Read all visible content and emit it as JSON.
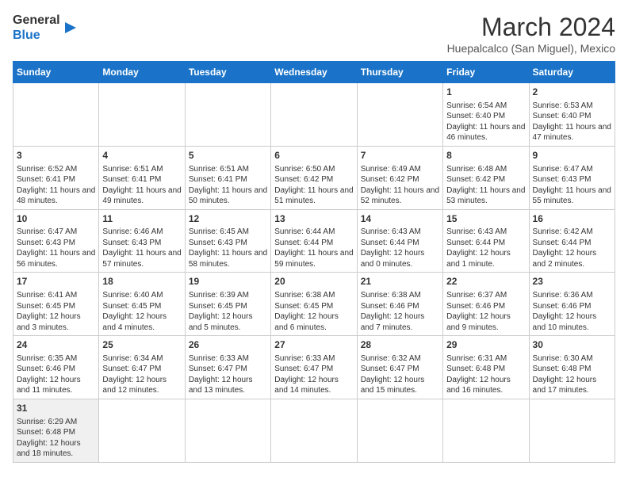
{
  "header": {
    "logo_general": "General",
    "logo_blue": "Blue",
    "title": "March 2024",
    "subtitle": "Huepalcalco (San Miguel), Mexico"
  },
  "weekdays": [
    "Sunday",
    "Monday",
    "Tuesday",
    "Wednesday",
    "Thursday",
    "Friday",
    "Saturday"
  ],
  "weeks": [
    [
      {
        "day": "",
        "info": ""
      },
      {
        "day": "",
        "info": ""
      },
      {
        "day": "",
        "info": ""
      },
      {
        "day": "",
        "info": ""
      },
      {
        "day": "",
        "info": ""
      },
      {
        "day": "1",
        "info": "Sunrise: 6:54 AM\nSunset: 6:40 PM\nDaylight: 11 hours and 46 minutes."
      },
      {
        "day": "2",
        "info": "Sunrise: 6:53 AM\nSunset: 6:40 PM\nDaylight: 11 hours and 47 minutes."
      }
    ],
    [
      {
        "day": "3",
        "info": "Sunrise: 6:52 AM\nSunset: 6:41 PM\nDaylight: 11 hours and 48 minutes."
      },
      {
        "day": "4",
        "info": "Sunrise: 6:51 AM\nSunset: 6:41 PM\nDaylight: 11 hours and 49 minutes."
      },
      {
        "day": "5",
        "info": "Sunrise: 6:51 AM\nSunset: 6:41 PM\nDaylight: 11 hours and 50 minutes."
      },
      {
        "day": "6",
        "info": "Sunrise: 6:50 AM\nSunset: 6:42 PM\nDaylight: 11 hours and 51 minutes."
      },
      {
        "day": "7",
        "info": "Sunrise: 6:49 AM\nSunset: 6:42 PM\nDaylight: 11 hours and 52 minutes."
      },
      {
        "day": "8",
        "info": "Sunrise: 6:48 AM\nSunset: 6:42 PM\nDaylight: 11 hours and 53 minutes."
      },
      {
        "day": "9",
        "info": "Sunrise: 6:47 AM\nSunset: 6:43 PM\nDaylight: 11 hours and 55 minutes."
      }
    ],
    [
      {
        "day": "10",
        "info": "Sunrise: 6:47 AM\nSunset: 6:43 PM\nDaylight: 11 hours and 56 minutes."
      },
      {
        "day": "11",
        "info": "Sunrise: 6:46 AM\nSunset: 6:43 PM\nDaylight: 11 hours and 57 minutes."
      },
      {
        "day": "12",
        "info": "Sunrise: 6:45 AM\nSunset: 6:43 PM\nDaylight: 11 hours and 58 minutes."
      },
      {
        "day": "13",
        "info": "Sunrise: 6:44 AM\nSunset: 6:44 PM\nDaylight: 11 hours and 59 minutes."
      },
      {
        "day": "14",
        "info": "Sunrise: 6:43 AM\nSunset: 6:44 PM\nDaylight: 12 hours and 0 minutes."
      },
      {
        "day": "15",
        "info": "Sunrise: 6:43 AM\nSunset: 6:44 PM\nDaylight: 12 hours and 1 minute."
      },
      {
        "day": "16",
        "info": "Sunrise: 6:42 AM\nSunset: 6:44 PM\nDaylight: 12 hours and 2 minutes."
      }
    ],
    [
      {
        "day": "17",
        "info": "Sunrise: 6:41 AM\nSunset: 6:45 PM\nDaylight: 12 hours and 3 minutes."
      },
      {
        "day": "18",
        "info": "Sunrise: 6:40 AM\nSunset: 6:45 PM\nDaylight: 12 hours and 4 minutes."
      },
      {
        "day": "19",
        "info": "Sunrise: 6:39 AM\nSunset: 6:45 PM\nDaylight: 12 hours and 5 minutes."
      },
      {
        "day": "20",
        "info": "Sunrise: 6:38 AM\nSunset: 6:45 PM\nDaylight: 12 hours and 6 minutes."
      },
      {
        "day": "21",
        "info": "Sunrise: 6:38 AM\nSunset: 6:46 PM\nDaylight: 12 hours and 7 minutes."
      },
      {
        "day": "22",
        "info": "Sunrise: 6:37 AM\nSunset: 6:46 PM\nDaylight: 12 hours and 9 minutes."
      },
      {
        "day": "23",
        "info": "Sunrise: 6:36 AM\nSunset: 6:46 PM\nDaylight: 12 hours and 10 minutes."
      }
    ],
    [
      {
        "day": "24",
        "info": "Sunrise: 6:35 AM\nSunset: 6:46 PM\nDaylight: 12 hours and 11 minutes."
      },
      {
        "day": "25",
        "info": "Sunrise: 6:34 AM\nSunset: 6:47 PM\nDaylight: 12 hours and 12 minutes."
      },
      {
        "day": "26",
        "info": "Sunrise: 6:33 AM\nSunset: 6:47 PM\nDaylight: 12 hours and 13 minutes."
      },
      {
        "day": "27",
        "info": "Sunrise: 6:33 AM\nSunset: 6:47 PM\nDaylight: 12 hours and 14 minutes."
      },
      {
        "day": "28",
        "info": "Sunrise: 6:32 AM\nSunset: 6:47 PM\nDaylight: 12 hours and 15 minutes."
      },
      {
        "day": "29",
        "info": "Sunrise: 6:31 AM\nSunset: 6:48 PM\nDaylight: 12 hours and 16 minutes."
      },
      {
        "day": "30",
        "info": "Sunrise: 6:30 AM\nSunset: 6:48 PM\nDaylight: 12 hours and 17 minutes."
      }
    ],
    [
      {
        "day": "31",
        "info": "Sunrise: 6:29 AM\nSunset: 6:48 PM\nDaylight: 12 hours and 18 minutes."
      },
      {
        "day": "",
        "info": ""
      },
      {
        "day": "",
        "info": ""
      },
      {
        "day": "",
        "info": ""
      },
      {
        "day": "",
        "info": ""
      },
      {
        "day": "",
        "info": ""
      },
      {
        "day": "",
        "info": ""
      }
    ]
  ]
}
